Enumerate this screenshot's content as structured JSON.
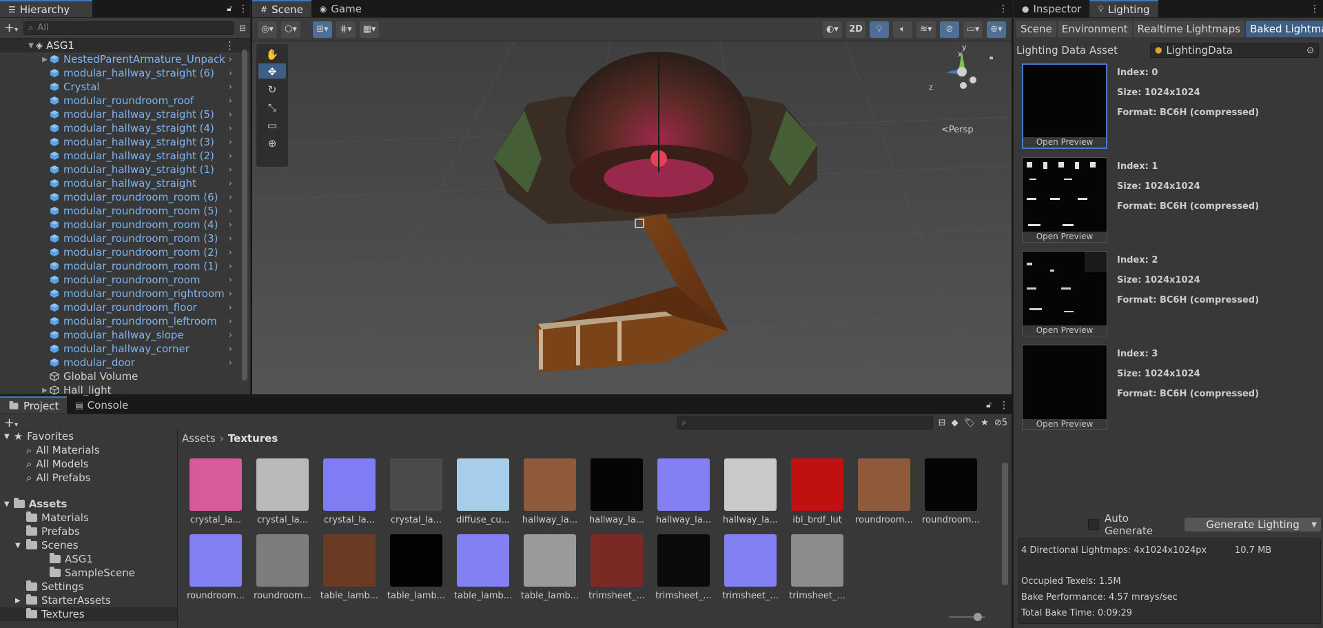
{
  "hierarchy": {
    "title": "Hierarchy",
    "search_placeholder": "All",
    "root": "ASG1",
    "items": [
      {
        "label": "NestedParentArmature_Unpack",
        "type": "prefab",
        "expandable": true
      },
      {
        "label": "modular_hallway_straight (6)",
        "type": "prefab"
      },
      {
        "label": "Crystal",
        "type": "prefab"
      },
      {
        "label": "modular_roundroom_roof",
        "type": "prefab"
      },
      {
        "label": "modular_hallway_straight (5)",
        "type": "prefab"
      },
      {
        "label": "modular_hallway_straight (4)",
        "type": "prefab"
      },
      {
        "label": "modular_hallway_straight (3)",
        "type": "prefab"
      },
      {
        "label": "modular_hallway_straight (2)",
        "type": "prefab"
      },
      {
        "label": "modular_hallway_straight (1)",
        "type": "prefab"
      },
      {
        "label": "modular_hallway_straight",
        "type": "prefab"
      },
      {
        "label": "modular_roundroom_room (6)",
        "type": "prefab"
      },
      {
        "label": "modular_roundroom_room (5)",
        "type": "prefab"
      },
      {
        "label": "modular_roundroom_room (4)",
        "type": "prefab"
      },
      {
        "label": "modular_roundroom_room (3)",
        "type": "prefab"
      },
      {
        "label": "modular_roundroom_room (2)",
        "type": "prefab"
      },
      {
        "label": "modular_roundroom_room (1)",
        "type": "prefab"
      },
      {
        "label": "modular_roundroom_room",
        "type": "prefab"
      },
      {
        "label": "modular_roundroom_rightroom",
        "type": "prefab"
      },
      {
        "label": "modular_roundroom_floor",
        "type": "prefab"
      },
      {
        "label": "modular_roundroom_leftroom",
        "type": "prefab"
      },
      {
        "label": "modular_hallway_slope",
        "type": "prefab"
      },
      {
        "label": "modular_hallway_corner",
        "type": "prefab"
      },
      {
        "label": "modular_door",
        "type": "prefab"
      },
      {
        "label": "Global Volume",
        "type": "object"
      },
      {
        "label": "Hall_light",
        "type": "object",
        "expandable": true
      }
    ]
  },
  "scene": {
    "tabs": [
      "Scene",
      "Game"
    ],
    "active_tab": "Scene",
    "toggle_2d": "2D",
    "persp_label": "Persp",
    "gizmo_axes": {
      "y": "y",
      "x": "x",
      "z": "z"
    }
  },
  "inspector": {
    "tabs": [
      "Inspector",
      "Lighting"
    ],
    "active_tab": "Lighting",
    "subtabs": [
      "Scene",
      "Environment",
      "Realtime Lightmaps",
      "Baked Lightmaps"
    ],
    "active_subtab": "Baked Lightmaps",
    "data_asset_label": "Lighting Data Asset",
    "data_asset_value": "LightingData",
    "lightmaps": [
      {
        "index": "Index: 0",
        "size": "Size: 1024x1024",
        "format": "Format: BC6H (compressed)",
        "button": "Open Preview"
      },
      {
        "index": "Index: 1",
        "size": "Size: 1024x1024",
        "format": "Format: BC6H (compressed)",
        "button": "Open Preview"
      },
      {
        "index": "Index: 2",
        "size": "Size: 1024x1024",
        "format": "Format: BC6H (compressed)",
        "button": "Open Preview"
      },
      {
        "index": "Index: 3",
        "size": "Size: 1024x1024",
        "format": "Format: BC6H (compressed)",
        "button": "Open Preview"
      }
    ],
    "auto_generate": "Auto Generate",
    "generate_button": "Generate Lighting",
    "stats": {
      "directional": "4 Directional Lightmaps: 4x1024x1024px",
      "size": "10.7 MB",
      "occupied": "Occupied Texels: 1.5M",
      "performance": "Bake Performance: 4.57 mrays/sec",
      "total_time": "Total Bake Time: 0:09:29"
    }
  },
  "project": {
    "tabs": [
      "Project",
      "Console"
    ],
    "active_tab": "Project",
    "hidden_count": "5",
    "breadcrumb": [
      "Assets",
      "Textures"
    ],
    "favorites_title": "Favorites",
    "favorites": [
      "All Materials",
      "All Models",
      "All Prefabs"
    ],
    "assets_title": "Assets",
    "folders": [
      {
        "label": "Materials",
        "depth": 1
      },
      {
        "label": "Prefabs",
        "depth": 1
      },
      {
        "label": "Scenes",
        "depth": 1,
        "open": true
      },
      {
        "label": "ASG1",
        "depth": 2
      },
      {
        "label": "SampleScene",
        "depth": 2
      },
      {
        "label": "Settings",
        "depth": 1
      },
      {
        "label": "StarterAssets",
        "depth": 1,
        "expandable": true
      },
      {
        "label": "Textures",
        "depth": 1,
        "selected": true
      }
    ],
    "textures": [
      {
        "label": "crystal_la...",
        "color": "#d85a9a"
      },
      {
        "label": "crystal_la...",
        "color": "#b9b9b9"
      },
      {
        "label": "crystal_la...",
        "color": "#7f7cf4"
      },
      {
        "label": "crystal_la...",
        "color": "#4a4a4a"
      },
      {
        "label": "diffuse_cu...",
        "color": "#a6cdea"
      },
      {
        "label": "hallway_la...",
        "color": "#8f5a3a"
      },
      {
        "label": "hallway_la...",
        "color": "#050505"
      },
      {
        "label": "hallway_la...",
        "color": "#8280f3"
      },
      {
        "label": "hallway_la...",
        "color": "#c9c9c9"
      },
      {
        "label": "ibl_brdf_lut",
        "color": "#c01010"
      },
      {
        "label": "roundroom...",
        "color": "#8f5a3a"
      },
      {
        "label": "roundroom...",
        "color": "#050505"
      },
      {
        "label": "roundroom...",
        "color": "#8280f3"
      },
      {
        "label": "roundroom...",
        "color": "#7d7d7d"
      },
      {
        "label": "table_lamb...",
        "color": "#6a3a22"
      },
      {
        "label": "table_lamb...",
        "color": "#020202"
      },
      {
        "label": "table_lamb...",
        "color": "#8280f3"
      },
      {
        "label": "table_lamb...",
        "color": "#9a9a9a"
      },
      {
        "label": "trimsheet_...",
        "color": "#7a2a22"
      },
      {
        "label": "trimsheet_...",
        "color": "#0a0a0a"
      },
      {
        "label": "trimsheet_...",
        "color": "#8280f3"
      },
      {
        "label": "trimsheet_...",
        "color": "#8c8c8c"
      }
    ]
  }
}
